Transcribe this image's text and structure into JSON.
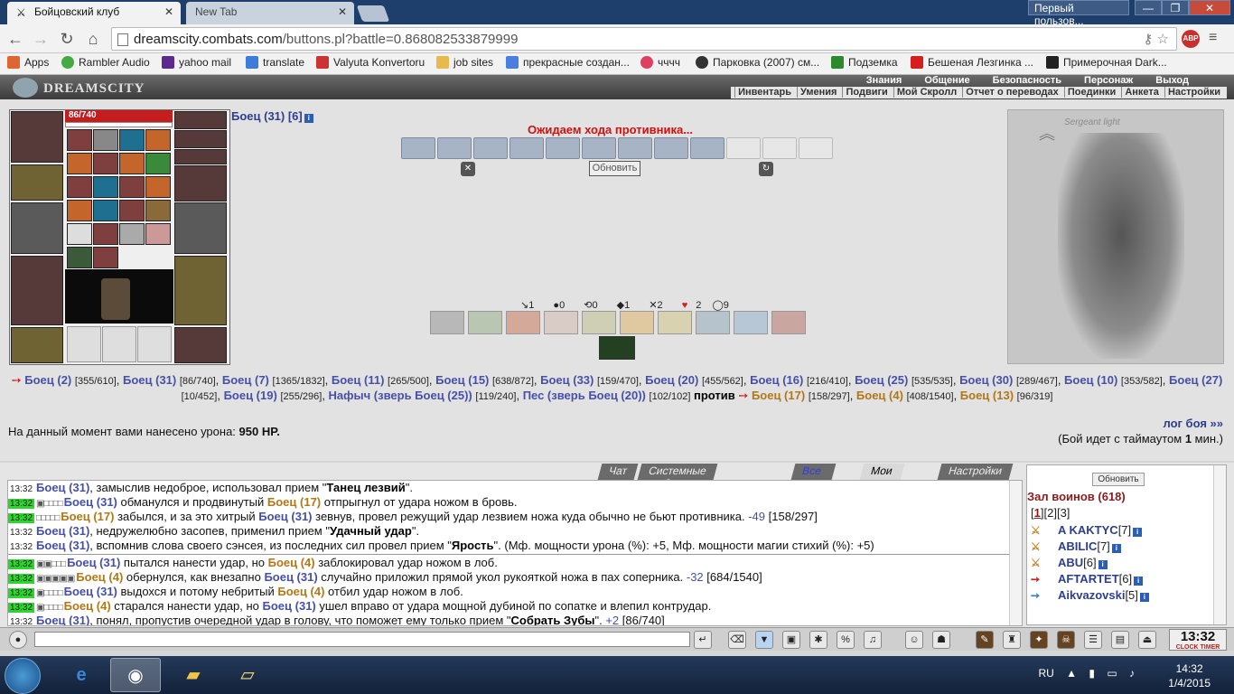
{
  "browser": {
    "tabs": [
      {
        "title": "Бойцовский клуб",
        "active": true
      },
      {
        "title": "New Tab",
        "active": false
      }
    ],
    "profile": "Первый пользов...",
    "url_domain": "dreamscity.combats.com",
    "url_path": "/buttons.pl?battle=0.868082533879999",
    "abp": "ABP",
    "bookmarks": [
      "Apps",
      "Rambler Audio",
      "yahoo mail",
      "translate",
      "Valyuta Konvertoru",
      "job sites",
      "прекрасные создан...",
      "чччч",
      "Парковка (2007) см...",
      "Подземка",
      "Бешеная Лезгинка ...",
      "Примерочная Dark..."
    ]
  },
  "game": {
    "logo": "DREAMSCITY",
    "menu_top": [
      "Знания",
      "Общение",
      "Безопасность",
      "Персонаж",
      "Выход"
    ],
    "menu_bottom": [
      "Инвентарь",
      "Умения",
      "Подвиги",
      "Мой Скролл",
      "Отчет о переводах",
      "Поединки",
      "Анкета",
      "Настройки"
    ],
    "hp": "86/740",
    "fighter": "Боец (31) [6]",
    "waiting": "Ожидаем хода противника...",
    "refresh": "Обновить",
    "counters": [
      "1",
      "0",
      "0",
      "1",
      "2",
      "2",
      "9"
    ],
    "portrait_label": "Sergeant light",
    "fighters_line1": [
      {
        "name": "Боец (2)",
        "hp": "[355/610]"
      },
      {
        "name": "Боец (31)",
        "hp": "[86/740]"
      },
      {
        "name": "Боец (7)",
        "hp": "[1365/1832]"
      },
      {
        "name": "Боец (11)",
        "hp": "[265/500]"
      },
      {
        "name": "Боец (15)",
        "hp": "[638/872]"
      },
      {
        "name": "Боец (33)",
        "hp": "[159/470]"
      },
      {
        "name": "Боец (20)",
        "hp": "[455/562]"
      },
      {
        "name": "Боец (16)",
        "hp": "[216/410]"
      },
      {
        "name": "Боец (25)",
        "hp": "[535/535]"
      }
    ],
    "fighters_line2": [
      {
        "name": "Боец (30)",
        "hp": "[289/467]"
      },
      {
        "name": "Боец (10)",
        "hp": "[353/582]"
      },
      {
        "name": "Боец (27)",
        "hp": "[10/452]"
      },
      {
        "name": "Боец (19)",
        "hp": "[255/296]"
      },
      {
        "name": "Нафыч (зверь Боец (25))",
        "hp": "[119/240]"
      },
      {
        "name": "Пес (зверь Боец (20))",
        "hp": "[102/102]"
      }
    ],
    "vs": "против",
    "enemies": [
      {
        "name": "Боец (17)",
        "hp": "[158/297]"
      },
      {
        "name": "Боец (4)",
        "hp": "[408/1540]"
      },
      {
        "name": "Боец (13)",
        "hp": "[96/319]"
      }
    ],
    "damage_label": "На данный момент вами нанесено урона:",
    "damage_value": "950 HP.",
    "log_link": "лог боя »»",
    "timeout_pre": "(Бой идет с таймаутом ",
    "timeout_num": "1",
    "timeout_post": " мин.)"
  },
  "chat": {
    "tabs": [
      "Чат",
      "Системные сообщения",
      "Все логи",
      "Мои логи",
      "Настройки"
    ],
    "log": [
      {
        "time": "13:32",
        "hl": false,
        "html": "<b>Боец (31)</b>, замыслив недоброе, использовал прием \"<span class='kw'>Танец лезвий</span>\"."
      },
      {
        "time": "13:32",
        "hl": true,
        "html": "<span class='boxes'>▣□□□□</span><b>Боец (31)</b> обманулся и продвинутый <b class='o'>Боец (17)</b> отпрыгнул от удара ножом в бровь."
      },
      {
        "time": "13:32",
        "hl": true,
        "html": "<span class='boxes'>□□□□□</span><b class='o'>Боец (17)</b> забылся, и за это хитрый <b>Боец (31)</b> зевнув, провел режущий удар лезвием ножа куда обычно не бьют противника. <span class='neg'>-49</span> [158/297]"
      },
      {
        "time": "13:32",
        "hl": false,
        "html": "<b>Боец (31)</b>, недружелюбно засопев, применил прием \"<span class='kw'>Удачный удар</span>\"."
      },
      {
        "time": "13:32",
        "hl": false,
        "html": "<b>Боец (31)</b>, вспомнив слова своего сэнсея, из последних сил провел прием \"<span class='kw'>Ярость</span>\". (Мф. мощности урона (%): +5, Мф. мощности магии стихий (%): +5)"
      },
      {
        "time": "13:32",
        "hl": true,
        "sep": true,
        "html": "<span class='boxes'>▣▣□□□</span><b>Боец (31)</b> пытался нанести удар, но <b class='o'>Боец (4)</b> заблокировал удар ножом в лоб."
      },
      {
        "time": "13:32",
        "hl": true,
        "html": "<span class='boxes'>▣▣▣▣▣</span><b class='o'>Боец (4)</b> обернулся, как внезапно <b>Боец (31)</b> случайно приложил прямой укол рукояткой ножа в пах соперника. <span class='neg'>-32</span> [684/1540]"
      },
      {
        "time": "13:32",
        "hl": true,
        "html": "<span class='boxes'>▣□□□□</span><b>Боец (31)</b> выдохся и потому небритый <b class='o'>Боец (4)</b> отбил удар ножом в лоб."
      },
      {
        "time": "13:32",
        "hl": true,
        "html": "<span class='boxes'>▣□□□□</span><b class='o'>Боец (4)</b> старался нанести удар, но <b>Боец (31)</b> ушел вправо от удара мощной дубиной по сопатке и влепил контрудар."
      },
      {
        "time": "13:32",
        "hl": false,
        "html": "<b>Боец (31)</b>, понял, пропустив очередной удар в голову, что поможет ему только прием \"<span class='kw'>Собрать Зубы</span>\". <span class='neg'>+2</span> [86/740]"
      }
    ],
    "side_refresh": "Обновить",
    "hall": "Зал воинов (618)",
    "pages": [
      "1",
      "2",
      "3"
    ],
    "players": [
      {
        "name": "A KAKTYC",
        "lvl": "[7]"
      },
      {
        "name": "ABILIC",
        "lvl": "[7]"
      },
      {
        "name": "ABU",
        "lvl": "[6]"
      },
      {
        "name": "AFTARTET",
        "lvl": "[6]"
      },
      {
        "name": "Aikvazovski",
        "lvl": "[5]"
      }
    ],
    "clock": "13:32",
    "clock_label": "CLOCK TIMER"
  },
  "taskbar": {
    "lang": "RU",
    "time": "14:32",
    "date": "1/4/2015"
  }
}
